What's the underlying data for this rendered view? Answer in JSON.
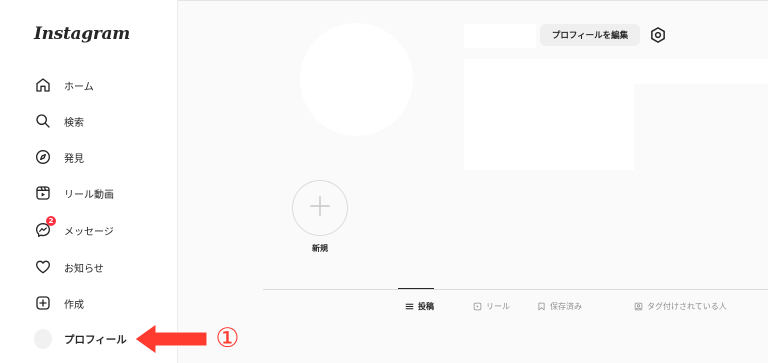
{
  "sidebar": {
    "logo": "Instagram",
    "items": [
      {
        "label": "ホーム",
        "icon": "home-icon"
      },
      {
        "label": "検索",
        "icon": "search-icon"
      },
      {
        "label": "発見",
        "icon": "compass-icon"
      },
      {
        "label": "リール動画",
        "icon": "reels-icon"
      },
      {
        "label": "メッセージ",
        "icon": "messenger-icon",
        "badge": "2"
      },
      {
        "label": "お知らせ",
        "icon": "heart-icon"
      },
      {
        "label": "作成",
        "icon": "plus-square-icon"
      },
      {
        "label": "プロフィール",
        "icon": "avatar"
      }
    ]
  },
  "profile": {
    "edit_button": "プロフィールを編集",
    "new_highlight_label": "新規"
  },
  "tabs": [
    {
      "label": "投稿",
      "icon": "grid-icon",
      "active": true
    },
    {
      "label": "リール",
      "icon": "reels-icon"
    },
    {
      "label": "保存済み",
      "icon": "bookmark-icon"
    },
    {
      "label": "タグ付けされている人",
      "icon": "tagged-icon"
    }
  ],
  "annotation": {
    "marker": "①",
    "color": "#ff3b30"
  },
  "colors": {
    "notification_badge": "#ff3040",
    "annotation_arrow": "#ff3b30"
  }
}
